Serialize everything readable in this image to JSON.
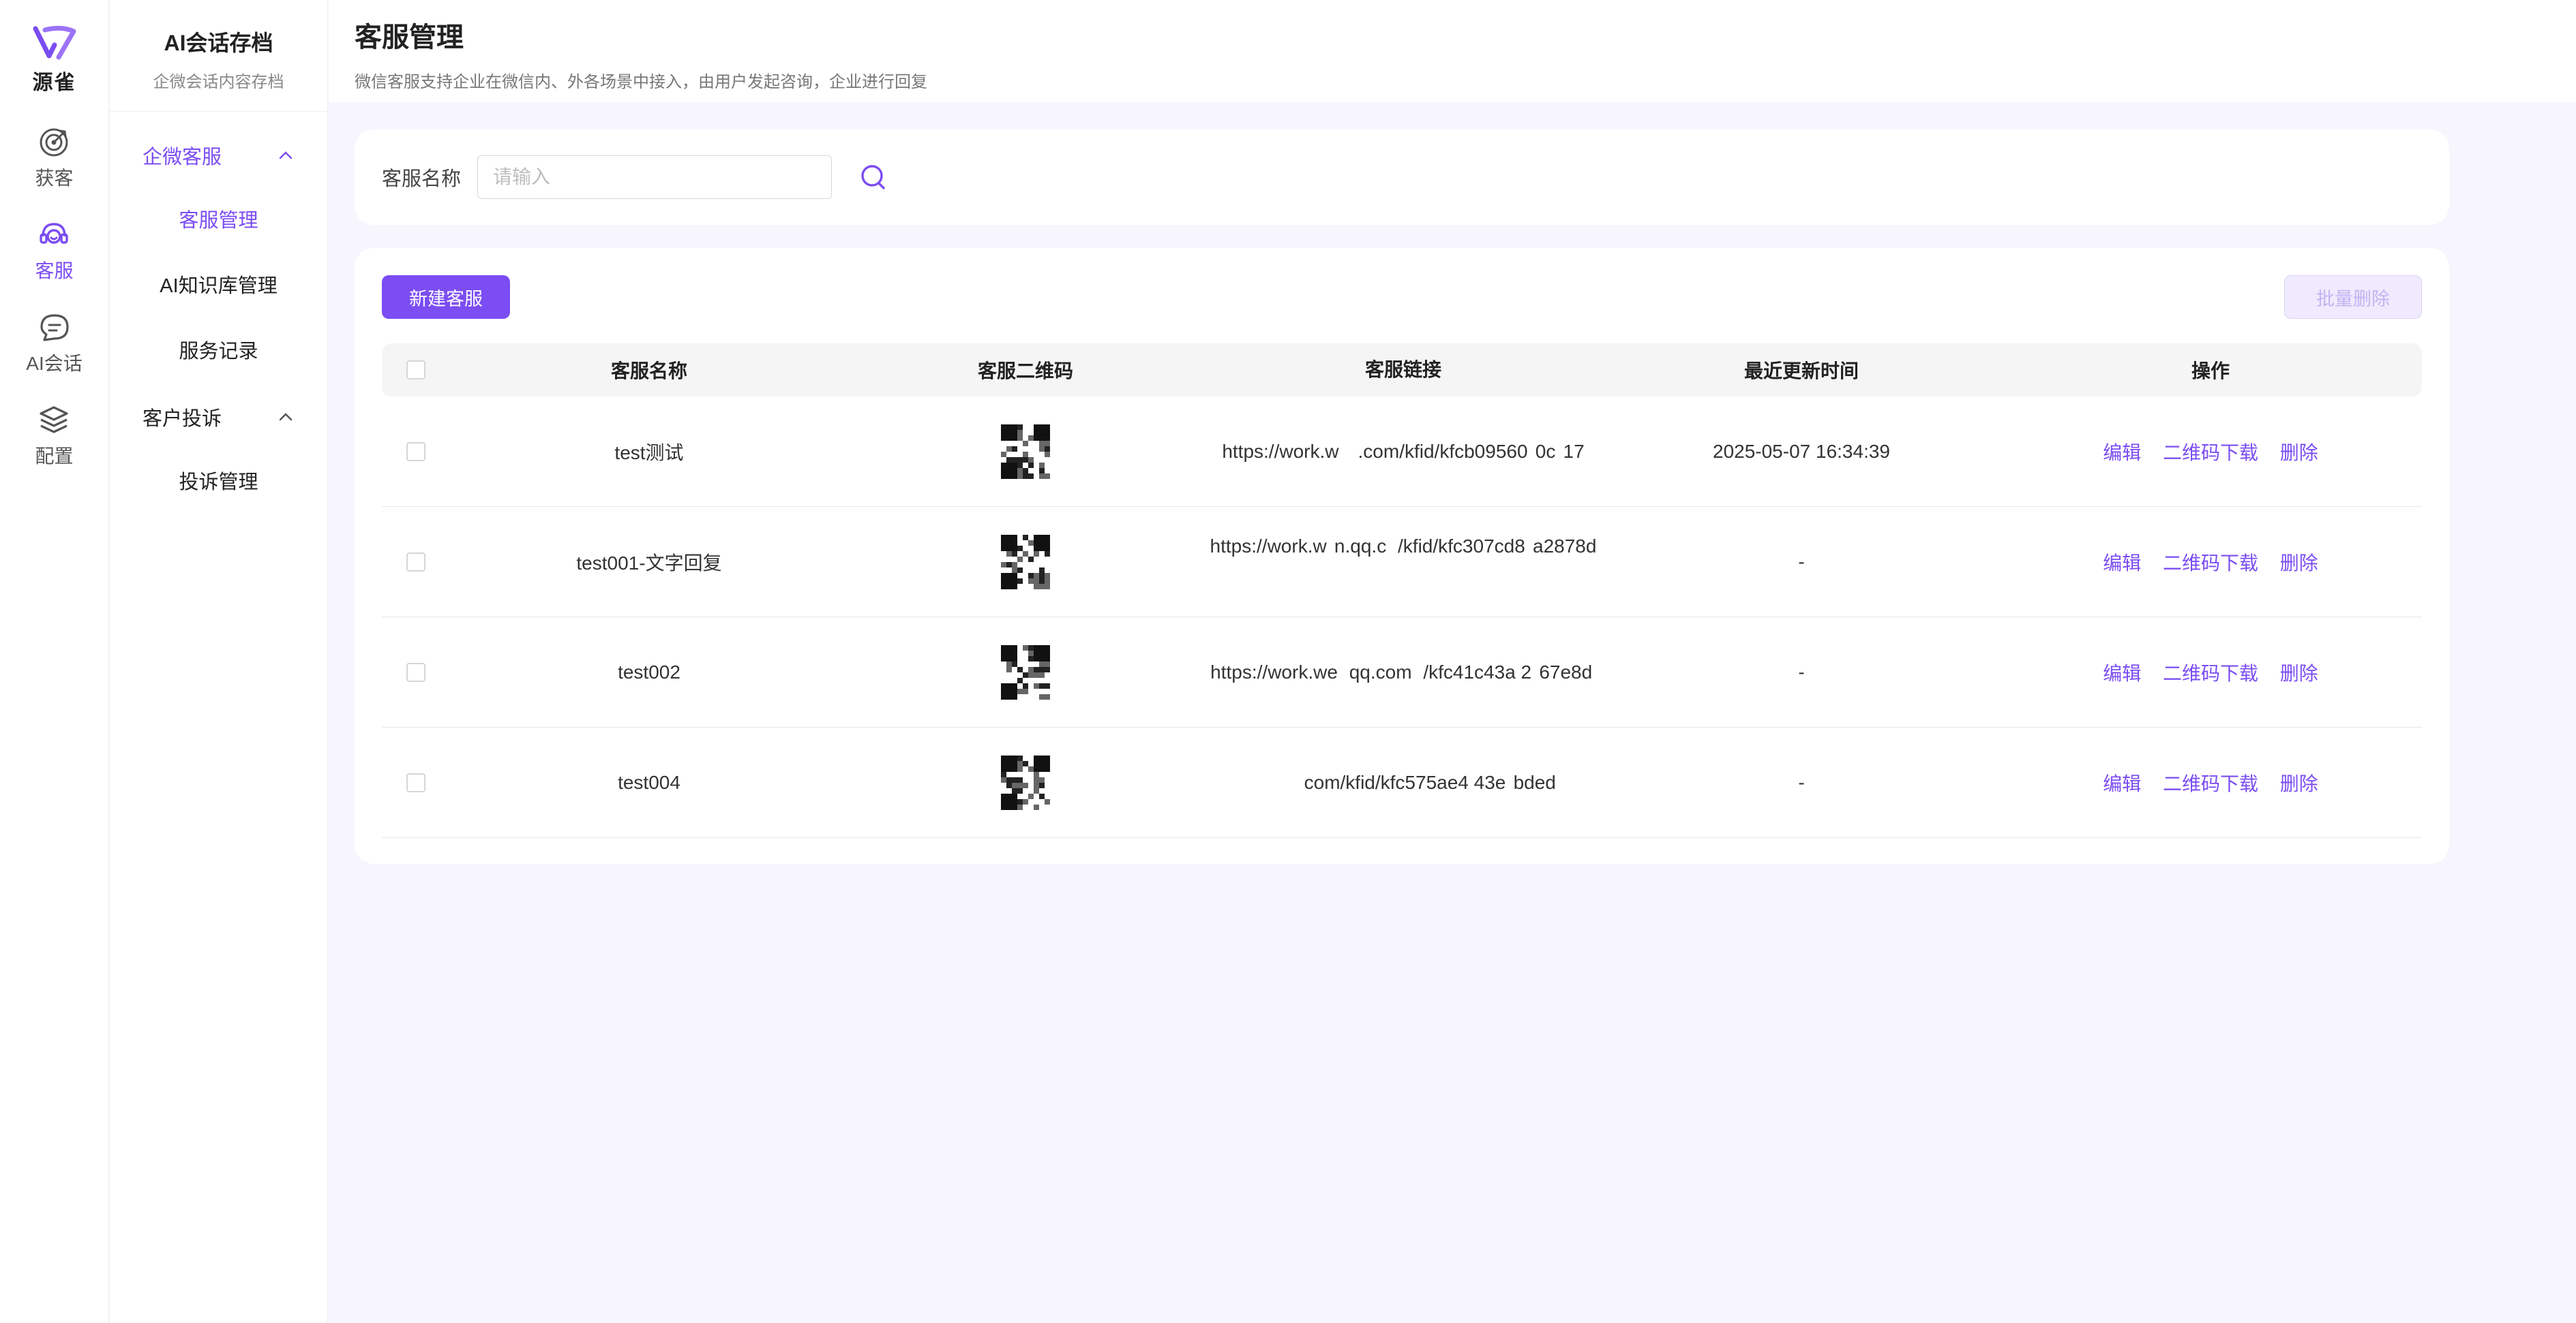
{
  "brand": {
    "name": "源雀",
    "color": "#7b4df2"
  },
  "rail": [
    {
      "label": "获客",
      "icon": "target-icon",
      "active": false
    },
    {
      "label": "客服",
      "icon": "headset-icon",
      "active": true
    },
    {
      "label": "AI会话",
      "icon": "chat-bubble-icon",
      "active": false
    },
    {
      "label": "配置",
      "icon": "layers-icon",
      "active": false
    }
  ],
  "submenu": {
    "title": "AI会话存档",
    "subtitle": "企微会话内容存档",
    "group1": "企微客服",
    "group1_items": [
      "客服管理",
      "AI知识库管理",
      "服务记录"
    ],
    "group2": "客户投诉",
    "group2_items": [
      "投诉管理"
    ]
  },
  "header": {
    "title": "客服管理",
    "description": "微信客服支持企业在微信内、外各场景中接入，由用户发起咨询，企业进行回复"
  },
  "search": {
    "label": "客服名称",
    "placeholder": "请输入",
    "value": ""
  },
  "toolbar": {
    "new_label": "新建客服",
    "batch_delete_label": "批量删除"
  },
  "table": {
    "columns": [
      "客服名称",
      "客服二维码",
      "客服链接",
      "最近更新时间",
      "操作"
    ],
    "actions": [
      "编辑",
      "二维码下载",
      "删除"
    ],
    "rows": [
      {
        "name": "test测试",
        "link": "https://work.w     .com/kfid/kfcb09560  0c  17",
        "updated": "2025-05-07 16:34:39"
      },
      {
        "name": "test001-文字回复",
        "link": "https://work.w  n.qq.c   /kfid/kfc307cd8  a2878d ",
        "updated": "-"
      },
      {
        "name": "test002",
        "link": "https://work.we   qq.com   /kfc41c43a 2  67e8d ",
        "updated": "-"
      },
      {
        "name": "test004",
        "link": "              com/kfid/kfc575ae4 43e  bded",
        "updated": "-"
      }
    ]
  }
}
